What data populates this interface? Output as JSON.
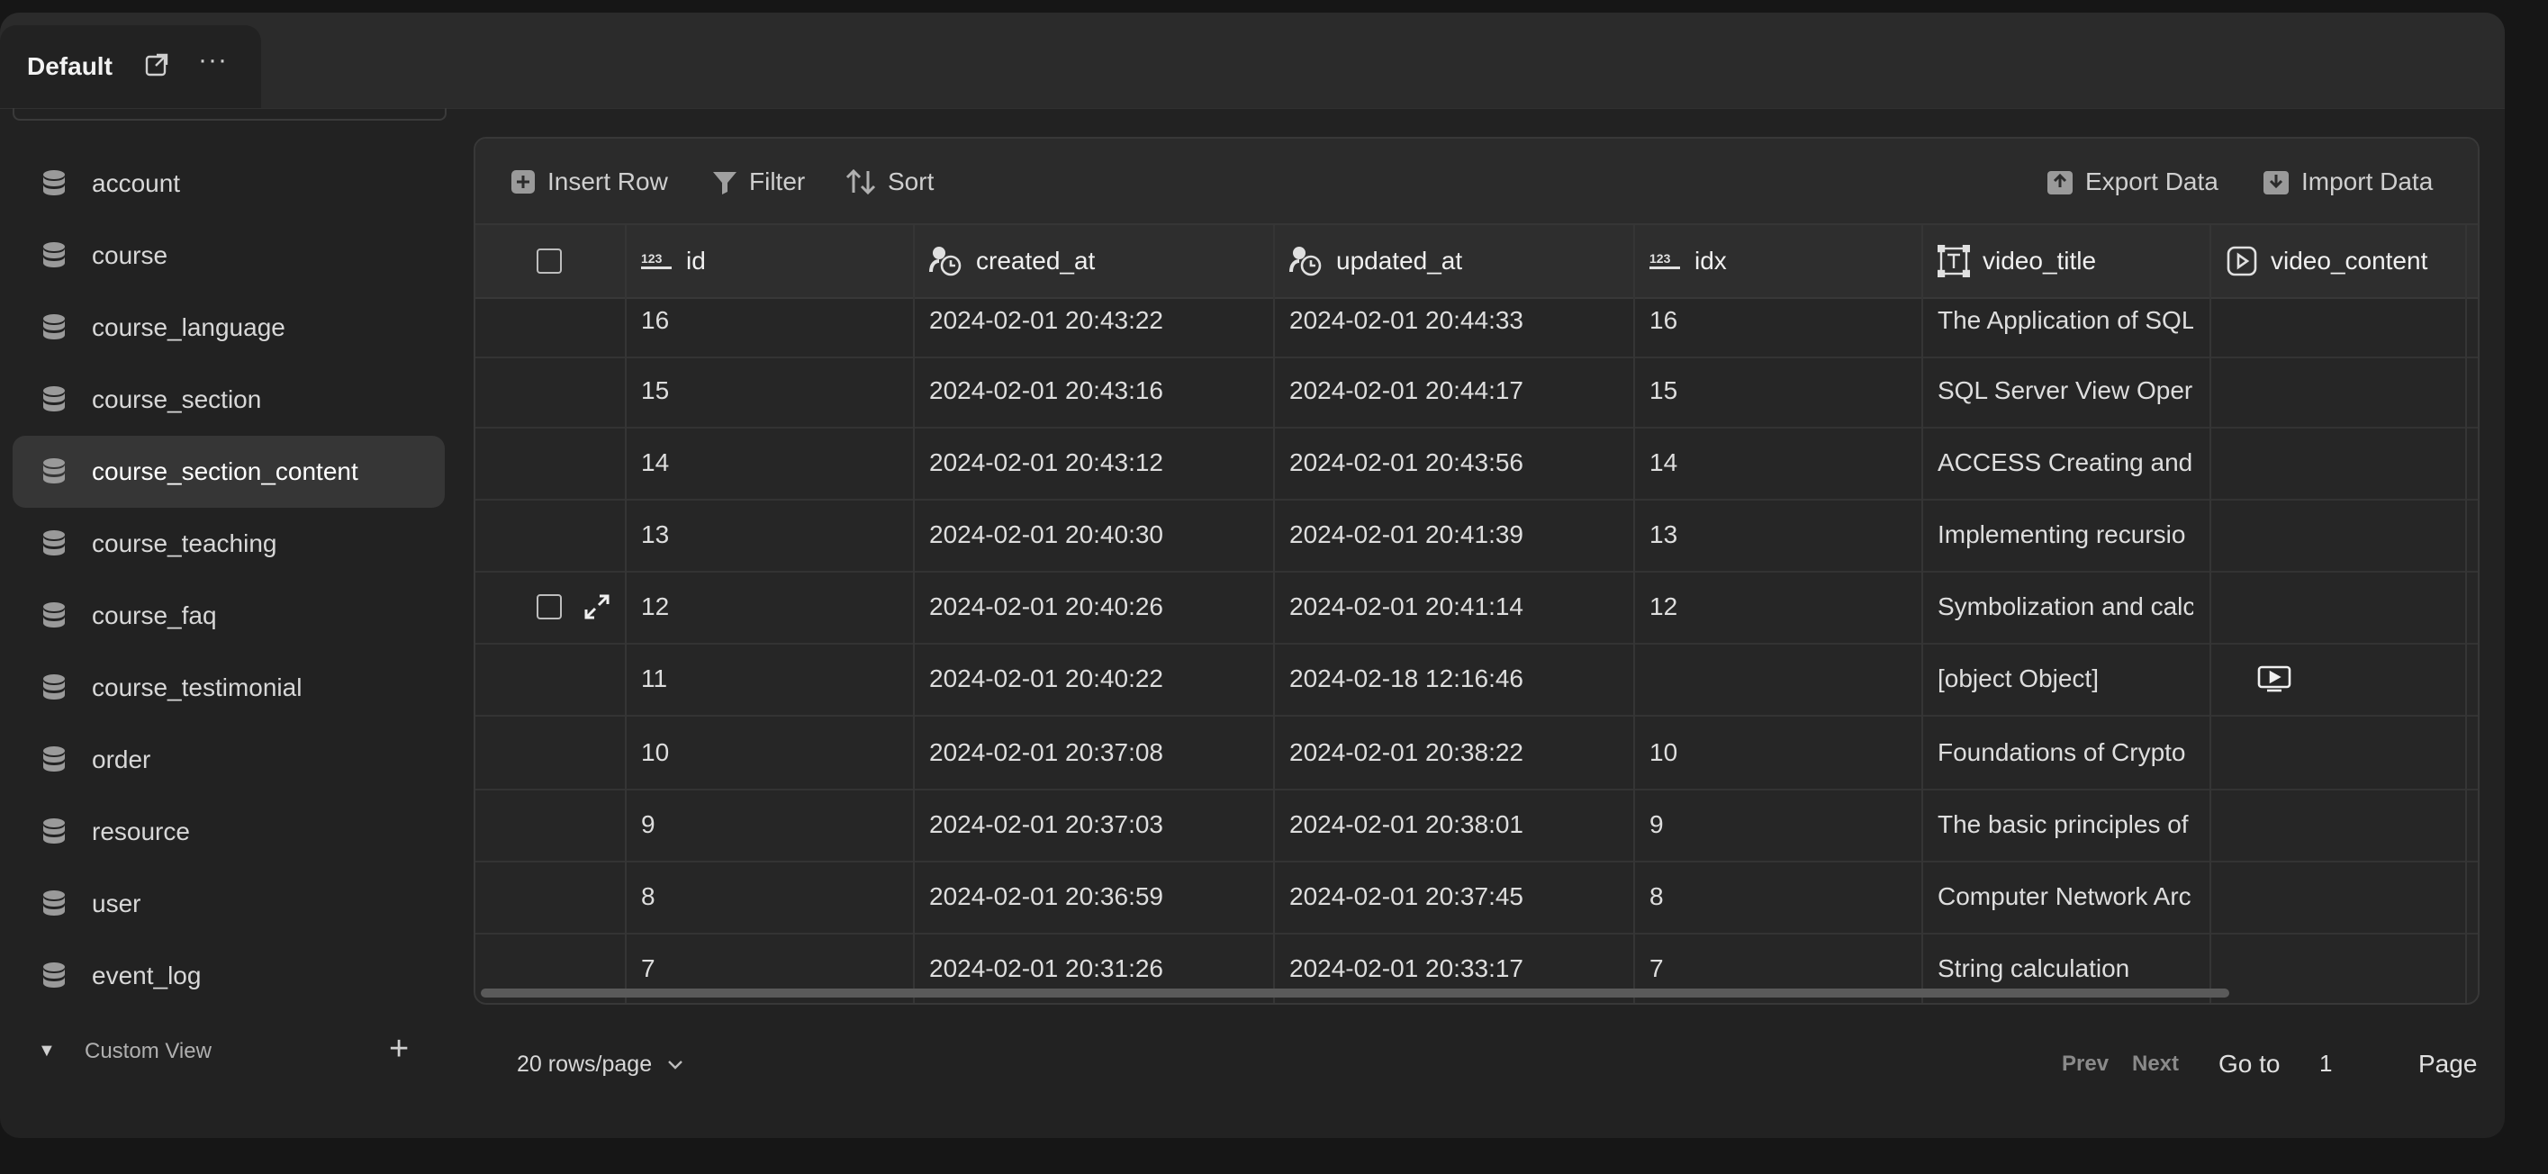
{
  "tab": {
    "title": "Default"
  },
  "sidebar": {
    "items": [
      {
        "label": "account"
      },
      {
        "label": "course"
      },
      {
        "label": "course_language"
      },
      {
        "label": "course_section"
      },
      {
        "label": "course_section_content"
      },
      {
        "label": "course_teaching"
      },
      {
        "label": "course_faq"
      },
      {
        "label": "course_testimonial"
      },
      {
        "label": "order"
      },
      {
        "label": "resource"
      },
      {
        "label": "user"
      },
      {
        "label": "event_log"
      }
    ],
    "active": "course_section_content",
    "custom_view_label": "Custom View"
  },
  "toolbar": {
    "insert_row": "Insert Row",
    "filter": "Filter",
    "sort": "Sort",
    "export": "Export Data",
    "import": "Import Data"
  },
  "columns": [
    {
      "label": "id",
      "icon": "number-icon"
    },
    {
      "label": "created_at",
      "icon": "clock-icon"
    },
    {
      "label": "updated_at",
      "icon": "clock-icon"
    },
    {
      "label": "idx",
      "icon": "number-icon"
    },
    {
      "label": "video_title",
      "icon": "text-icon"
    },
    {
      "label": "video_content",
      "icon": "video-icon"
    }
  ],
  "rows": [
    {
      "id": "16",
      "created_at": "2024-02-01 20:43:22",
      "updated_at": "2024-02-01 20:44:33",
      "idx": "16",
      "video_title": "The Application of SQL",
      "video_content": ""
    },
    {
      "id": "15",
      "created_at": "2024-02-01 20:43:16",
      "updated_at": "2024-02-01 20:44:17",
      "idx": "15",
      "video_title": "SQL Server View Oper",
      "video_content": ""
    },
    {
      "id": "14",
      "created_at": "2024-02-01 20:43:12",
      "updated_at": "2024-02-01 20:43:56",
      "idx": "14",
      "video_title": "ACCESS Creating and",
      "video_content": ""
    },
    {
      "id": "13",
      "created_at": "2024-02-01 20:40:30",
      "updated_at": "2024-02-01 20:41:39",
      "idx": "13",
      "video_title": "Implementing recursio",
      "video_content": ""
    },
    {
      "id": "12",
      "created_at": "2024-02-01 20:40:26",
      "updated_at": "2024-02-01 20:41:14",
      "idx": "12",
      "video_title": "Symbolization and calc",
      "video_content": ""
    },
    {
      "id": "11",
      "created_at": "2024-02-01 20:40:22",
      "updated_at": "2024-02-18 12:16:46",
      "idx": "",
      "video_title": "[object Object]",
      "video_content": "video-icon"
    },
    {
      "id": "10",
      "created_at": "2024-02-01 20:37:08",
      "updated_at": "2024-02-01 20:38:22",
      "idx": "10",
      "video_title": "Foundations of Crypto",
      "video_content": ""
    },
    {
      "id": "9",
      "created_at": "2024-02-01 20:37:03",
      "updated_at": "2024-02-01 20:38:01",
      "idx": "9",
      "video_title": "The basic principles of",
      "video_content": ""
    },
    {
      "id": "8",
      "created_at": "2024-02-01 20:36:59",
      "updated_at": "2024-02-01 20:37:45",
      "idx": "8",
      "video_title": "Computer Network Arc",
      "video_content": ""
    },
    {
      "id": "7",
      "created_at": "2024-02-01 20:31:26",
      "updated_at": "2024-02-01 20:33:17",
      "idx": "7",
      "video_title": "String calculation",
      "video_content": ""
    }
  ],
  "hovered_row_id": "12",
  "pagination": {
    "rows_per_page": "20 rows/page",
    "prev": "Prev",
    "next": "Next",
    "goto_label": "Go to",
    "page_value": "1",
    "page_label": "Page"
  },
  "colors": {
    "background": "#222222",
    "panel": "#262626",
    "active_item": "#363636"
  }
}
